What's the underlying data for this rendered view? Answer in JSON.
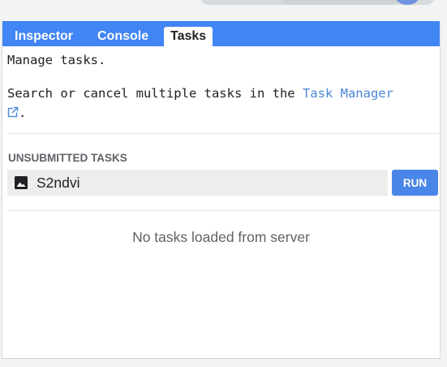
{
  "tabs": [
    {
      "label": "Inspector",
      "active": false
    },
    {
      "label": "Console",
      "active": false
    },
    {
      "label": "Tasks",
      "active": true
    }
  ],
  "intro": {
    "manage": "Manage tasks.",
    "search_prefix": "Search or cancel multiple tasks in the ",
    "task_manager_link": "Task Manager",
    "period": "."
  },
  "unsubmitted": {
    "title": "UNSUBMITTED TASKS",
    "tasks": [
      {
        "name": "S2ndvi",
        "icon": "image-icon",
        "run_label": "RUN"
      }
    ]
  },
  "server_message": "No tasks loaded from server",
  "colors": {
    "tab_bar": "#4285f4",
    "run_button": "#4a86e8",
    "link": "#4a86d9"
  }
}
